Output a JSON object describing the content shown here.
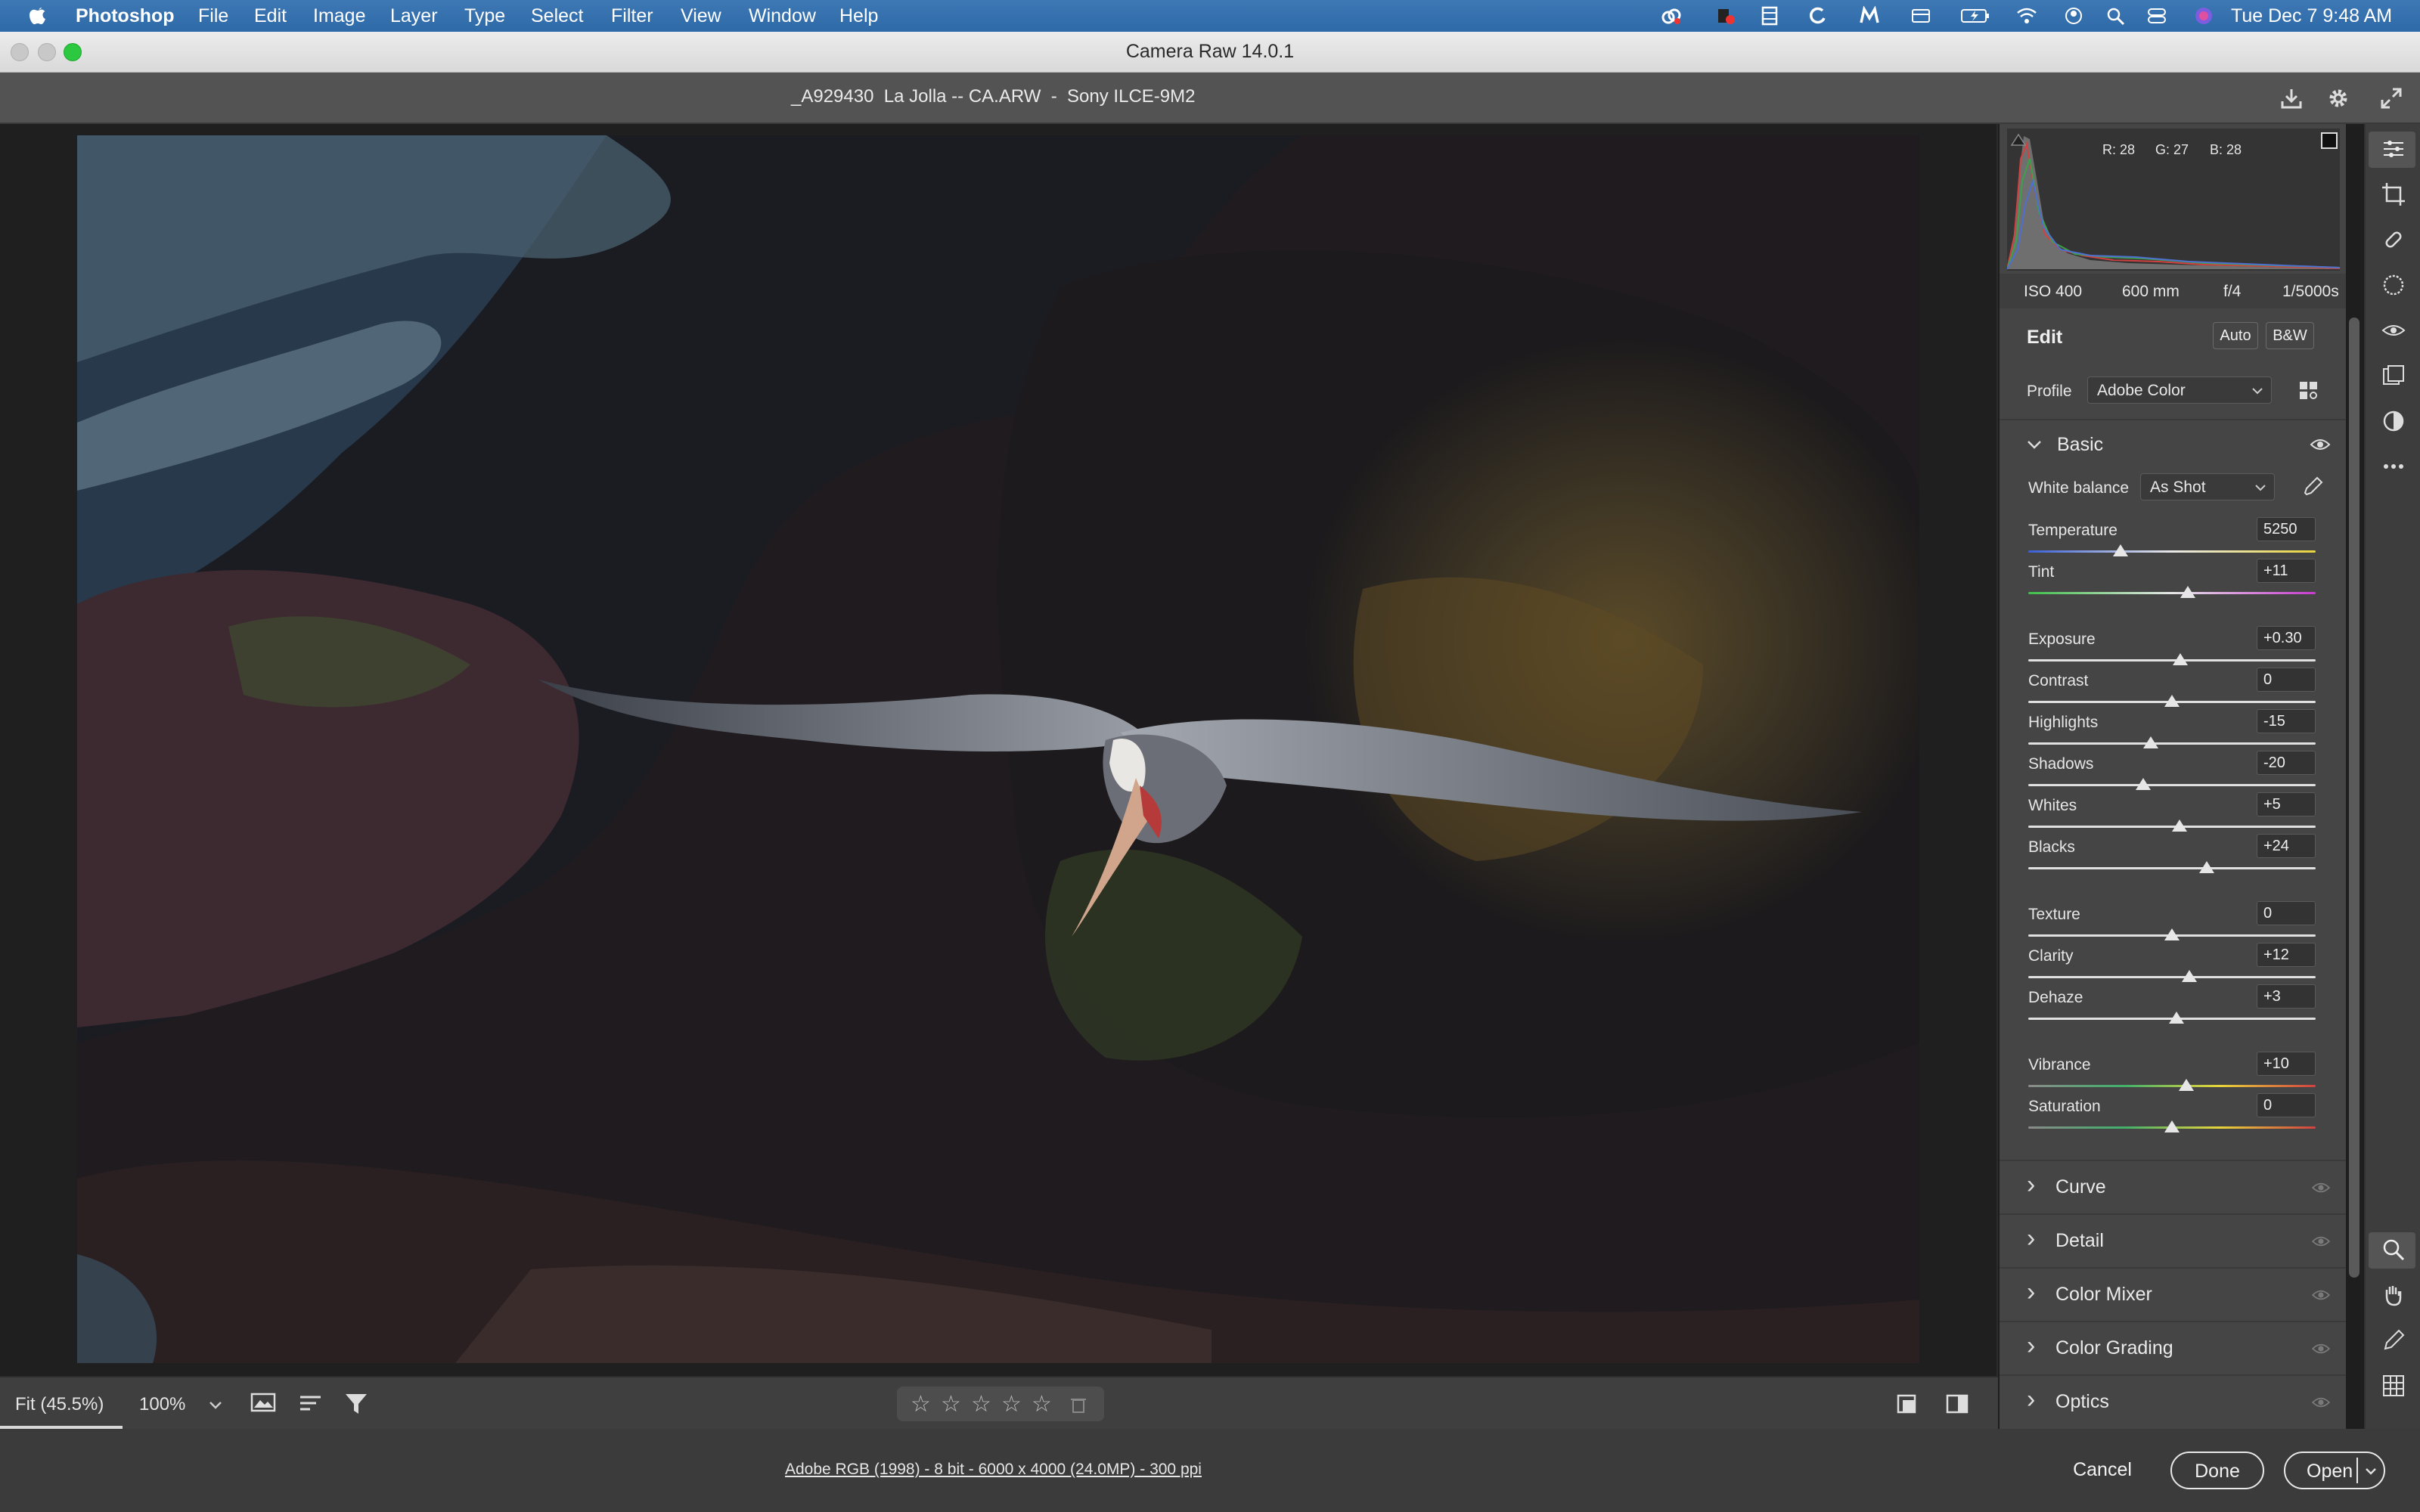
{
  "menubar": {
    "app_name": "Photoshop",
    "items": [
      "File",
      "Edit",
      "Image",
      "Layer",
      "Type",
      "Select",
      "Filter",
      "View",
      "Window",
      "Help"
    ],
    "clock": "Tue Dec 7  9:48 AM"
  },
  "window": {
    "title": "Camera Raw 14.0.1"
  },
  "header": {
    "file_info": "_A929430  La Jolla -- CA.ARW  -  Sony ILCE-9M2"
  },
  "histogram": {
    "r": "R: 28",
    "g": "G: 27",
    "b": "B: 28"
  },
  "exif": {
    "iso": "ISO 400",
    "focal": "600 mm",
    "aperture": "f/4",
    "shutter": "1/5000s"
  },
  "edit": {
    "title": "Edit",
    "auto_label": "Auto",
    "bw_label": "B&W",
    "profile_label": "Profile",
    "profile_value": "Adobe Color"
  },
  "basic": {
    "title": "Basic",
    "white_balance_label": "White balance",
    "white_balance_value": "As Shot",
    "sliders": [
      {
        "label": "Temperature",
        "value": "5250",
        "position": 0.32
      },
      {
        "label": "Tint",
        "value": "+11",
        "position": 0.555
      },
      {
        "label": "Exposure",
        "value": "+0.30",
        "position": 0.53
      },
      {
        "label": "Contrast",
        "value": "0",
        "position": 0.5
      },
      {
        "label": "Highlights",
        "value": "-15",
        "position": 0.425
      },
      {
        "label": "Shadows",
        "value": "-20",
        "position": 0.4
      },
      {
        "label": "Whites",
        "value": "+5",
        "position": 0.525
      },
      {
        "label": "Blacks",
        "value": "+24",
        "position": 0.62
      },
      {
        "label": "Texture",
        "value": "0",
        "position": 0.5
      },
      {
        "label": "Clarity",
        "value": "+12",
        "position": 0.56
      },
      {
        "label": "Dehaze",
        "value": "+3",
        "position": 0.515
      },
      {
        "label": "Vibrance",
        "value": "+10",
        "position": 0.55
      },
      {
        "label": "Saturation",
        "value": "0",
        "position": 0.5
      }
    ]
  },
  "sections": [
    "Curve",
    "Detail",
    "Color Mixer",
    "Color Grading",
    "Optics"
  ],
  "bottom_bar": {
    "zoom_fit": "Fit (45.5%)",
    "zoom_100": "100%"
  },
  "footer": {
    "workflow": "Adobe RGB (1998) - 8 bit - 6000 x 4000 (24.0MP) - 300 ppi",
    "cancel": "Cancel",
    "done": "Done",
    "open": "Open"
  }
}
